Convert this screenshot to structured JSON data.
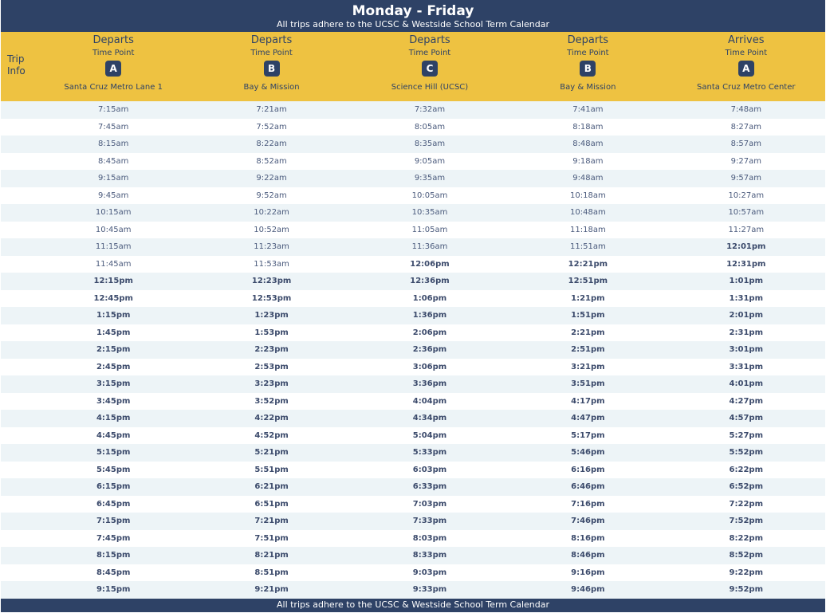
{
  "header": {
    "title": "Monday - Friday",
    "subtitle": "All trips adhere to the UCSC & Westside School Term Calendar",
    "trip_info": "Trip Info"
  },
  "columns": [
    {
      "kind": "Departs",
      "time_point": "Time Point",
      "badge": "A",
      "stop": "Santa Cruz Metro Lane 1"
    },
    {
      "kind": "Departs",
      "time_point": "Time Point",
      "badge": "B",
      "stop": "Bay & Mission"
    },
    {
      "kind": "Departs",
      "time_point": "Time Point",
      "badge": "C",
      "stop": "Science Hill (UCSC)"
    },
    {
      "kind": "Departs",
      "time_point": "Time Point",
      "badge": "B",
      "stop": "Bay & Mission"
    },
    {
      "kind": "Arrives",
      "time_point": "Time Point",
      "badge": "A",
      "stop": "Santa Cruz Metro Center"
    }
  ],
  "rows": [
    [
      "7:15am",
      "7:21am",
      "7:32am",
      "7:41am",
      "7:48am"
    ],
    [
      "7:45am",
      "7:52am",
      "8:05am",
      "8:18am",
      "8:27am"
    ],
    [
      "8:15am",
      "8:22am",
      "8:35am",
      "8:48am",
      "8:57am"
    ],
    [
      "8:45am",
      "8:52am",
      "9:05am",
      "9:18am",
      "9:27am"
    ],
    [
      "9:15am",
      "9:22am",
      "9:35am",
      "9:48am",
      "9:57am"
    ],
    [
      "9:45am",
      "9:52am",
      "10:05am",
      "10:18am",
      "10:27am"
    ],
    [
      "10:15am",
      "10:22am",
      "10:35am",
      "10:48am",
      "10:57am"
    ],
    [
      "10:45am",
      "10:52am",
      "11:05am",
      "11:18am",
      "11:27am"
    ],
    [
      "11:15am",
      "11:23am",
      "11:36am",
      "11:51am",
      "12:01pm"
    ],
    [
      "11:45am",
      "11:53am",
      "12:06pm",
      "12:21pm",
      "12:31pm"
    ],
    [
      "12:15pm",
      "12:23pm",
      "12:36pm",
      "12:51pm",
      "1:01pm"
    ],
    [
      "12:45pm",
      "12:53pm",
      "1:06pm",
      "1:21pm",
      "1:31pm"
    ],
    [
      "1:15pm",
      "1:23pm",
      "1:36pm",
      "1:51pm",
      "2:01pm"
    ],
    [
      "1:45pm",
      "1:53pm",
      "2:06pm",
      "2:21pm",
      "2:31pm"
    ],
    [
      "2:15pm",
      "2:23pm",
      "2:36pm",
      "2:51pm",
      "3:01pm"
    ],
    [
      "2:45pm",
      "2:53pm",
      "3:06pm",
      "3:21pm",
      "3:31pm"
    ],
    [
      "3:15pm",
      "3:23pm",
      "3:36pm",
      "3:51pm",
      "4:01pm"
    ],
    [
      "3:45pm",
      "3:52pm",
      "4:04pm",
      "4:17pm",
      "4:27pm"
    ],
    [
      "4:15pm",
      "4:22pm",
      "4:34pm",
      "4:47pm",
      "4:57pm"
    ],
    [
      "4:45pm",
      "4:52pm",
      "5:04pm",
      "5:17pm",
      "5:27pm"
    ],
    [
      "5:15pm",
      "5:21pm",
      "5:33pm",
      "5:46pm",
      "5:52pm"
    ],
    [
      "5:45pm",
      "5:51pm",
      "6:03pm",
      "6:16pm",
      "6:22pm"
    ],
    [
      "6:15pm",
      "6:21pm",
      "6:33pm",
      "6:46pm",
      "6:52pm"
    ],
    [
      "6:45pm",
      "6:51pm",
      "7:03pm",
      "7:16pm",
      "7:22pm"
    ],
    [
      "7:15pm",
      "7:21pm",
      "7:33pm",
      "7:46pm",
      "7:52pm"
    ],
    [
      "7:45pm",
      "7:51pm",
      "8:03pm",
      "8:16pm",
      "8:22pm"
    ],
    [
      "8:15pm",
      "8:21pm",
      "8:33pm",
      "8:46pm",
      "8:52pm"
    ],
    [
      "8:45pm",
      "8:51pm",
      "9:03pm",
      "9:16pm",
      "9:22pm"
    ],
    [
      "9:15pm",
      "9:21pm",
      "9:33pm",
      "9:46pm",
      "9:52pm"
    ]
  ],
  "footer": {
    "text": "All trips adhere to the UCSC & Westside School Term Calendar"
  },
  "colors": {
    "header_bg": "#2e4266",
    "column_header_bg": "#eec241",
    "row_alt_bg": "#edf4f7",
    "text": "#2e4266"
  }
}
